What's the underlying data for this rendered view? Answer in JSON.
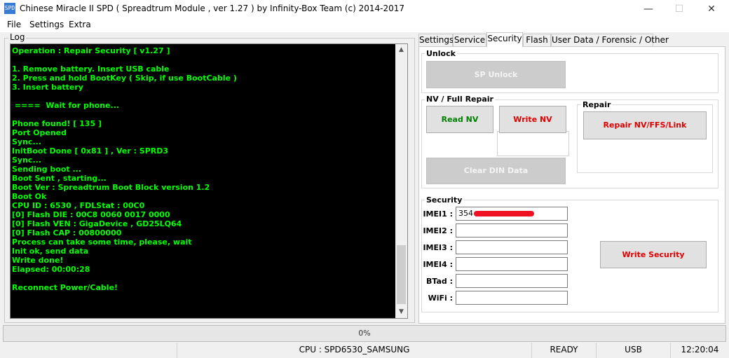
{
  "window": {
    "icon_text": "SPD",
    "title": "Chinese Miracle II SPD ( Spreadtrum Module , ver 1.27 ) by Infinity-Box Team (c) 2014-2017",
    "minimize": "—",
    "maximize": "☐",
    "close": "✕"
  },
  "menu": {
    "file": "File",
    "settings": "Settings",
    "extra": "Extra"
  },
  "log": {
    "label": "Log",
    "lines": [
      "Operation : Repair Security [ v1.27 ]",
      "",
      "1. Remove battery. Insert USB cable",
      "2. Press and hold BootKey ( Skip, if use BootCable )",
      "3. Insert battery",
      "",
      " ====  Wait for phone...",
      "",
      "Phone found! [ 135 ]",
      "Port Opened",
      "Sync...",
      "InitBoot Done [ 0x81 ] , Ver : SPRD3",
      "Sync...",
      "Sending boot ...",
      "Boot Sent , starting...",
      "Boot Ver : Spreadtrum Boot Block version 1.2",
      "Boot Ok",
      "CPU ID : 6530 , FDLStat : 00C0",
      "[0] Flash DIE : 00C8 0060 0017 0000",
      "[0] Flash VEN : GigaDevice , GD25LQ64",
      "[0] Flash CAP : 00800000",
      "Process can take some time, please, wait",
      "Init ok, send data",
      "Write done!",
      "Elapsed: 00:00:28",
      "",
      "Reconnect Power/Cable!"
    ],
    "scroll_up": "▲",
    "scroll_down": "▼"
  },
  "tabs": [
    {
      "label": "Settings"
    },
    {
      "label": "Service"
    },
    {
      "label": "Security"
    },
    {
      "label": "Flash"
    },
    {
      "label": "User Data / Forensic / Other"
    }
  ],
  "security_tab": {
    "unlock": {
      "title": "Unlock",
      "sp_unlock": "SP Unlock"
    },
    "nv": {
      "title": "NV / Full Repair",
      "read_nv": "Read NV",
      "write_nv": "Write NV",
      "clear_din": "Clear DIN Data"
    },
    "repair": {
      "title": "Repair",
      "repair_btn": "Repair NV/FFS/Link"
    },
    "security": {
      "title": "Security",
      "fields": [
        {
          "label": "IMEI1 :",
          "value": "354"
        },
        {
          "label": "IMEI2 :",
          "value": ""
        },
        {
          "label": "IMEI3 :",
          "value": ""
        },
        {
          "label": "IMEI4 :",
          "value": ""
        },
        {
          "label": "BTad :",
          "value": ""
        },
        {
          "label": "WiFi :",
          "value": ""
        }
      ],
      "write_btn": "Write Security"
    }
  },
  "progress": {
    "text": "0%",
    "value": 0
  },
  "status": {
    "cpu": "CPU : SPD6530_SAMSUNG",
    "state": "READY",
    "port": "USB",
    "time": "12:20:04"
  },
  "colors": {
    "log_text": "#00ff00",
    "log_bg": "#000000",
    "green_button": "#008000",
    "red_button": "#e00000"
  }
}
